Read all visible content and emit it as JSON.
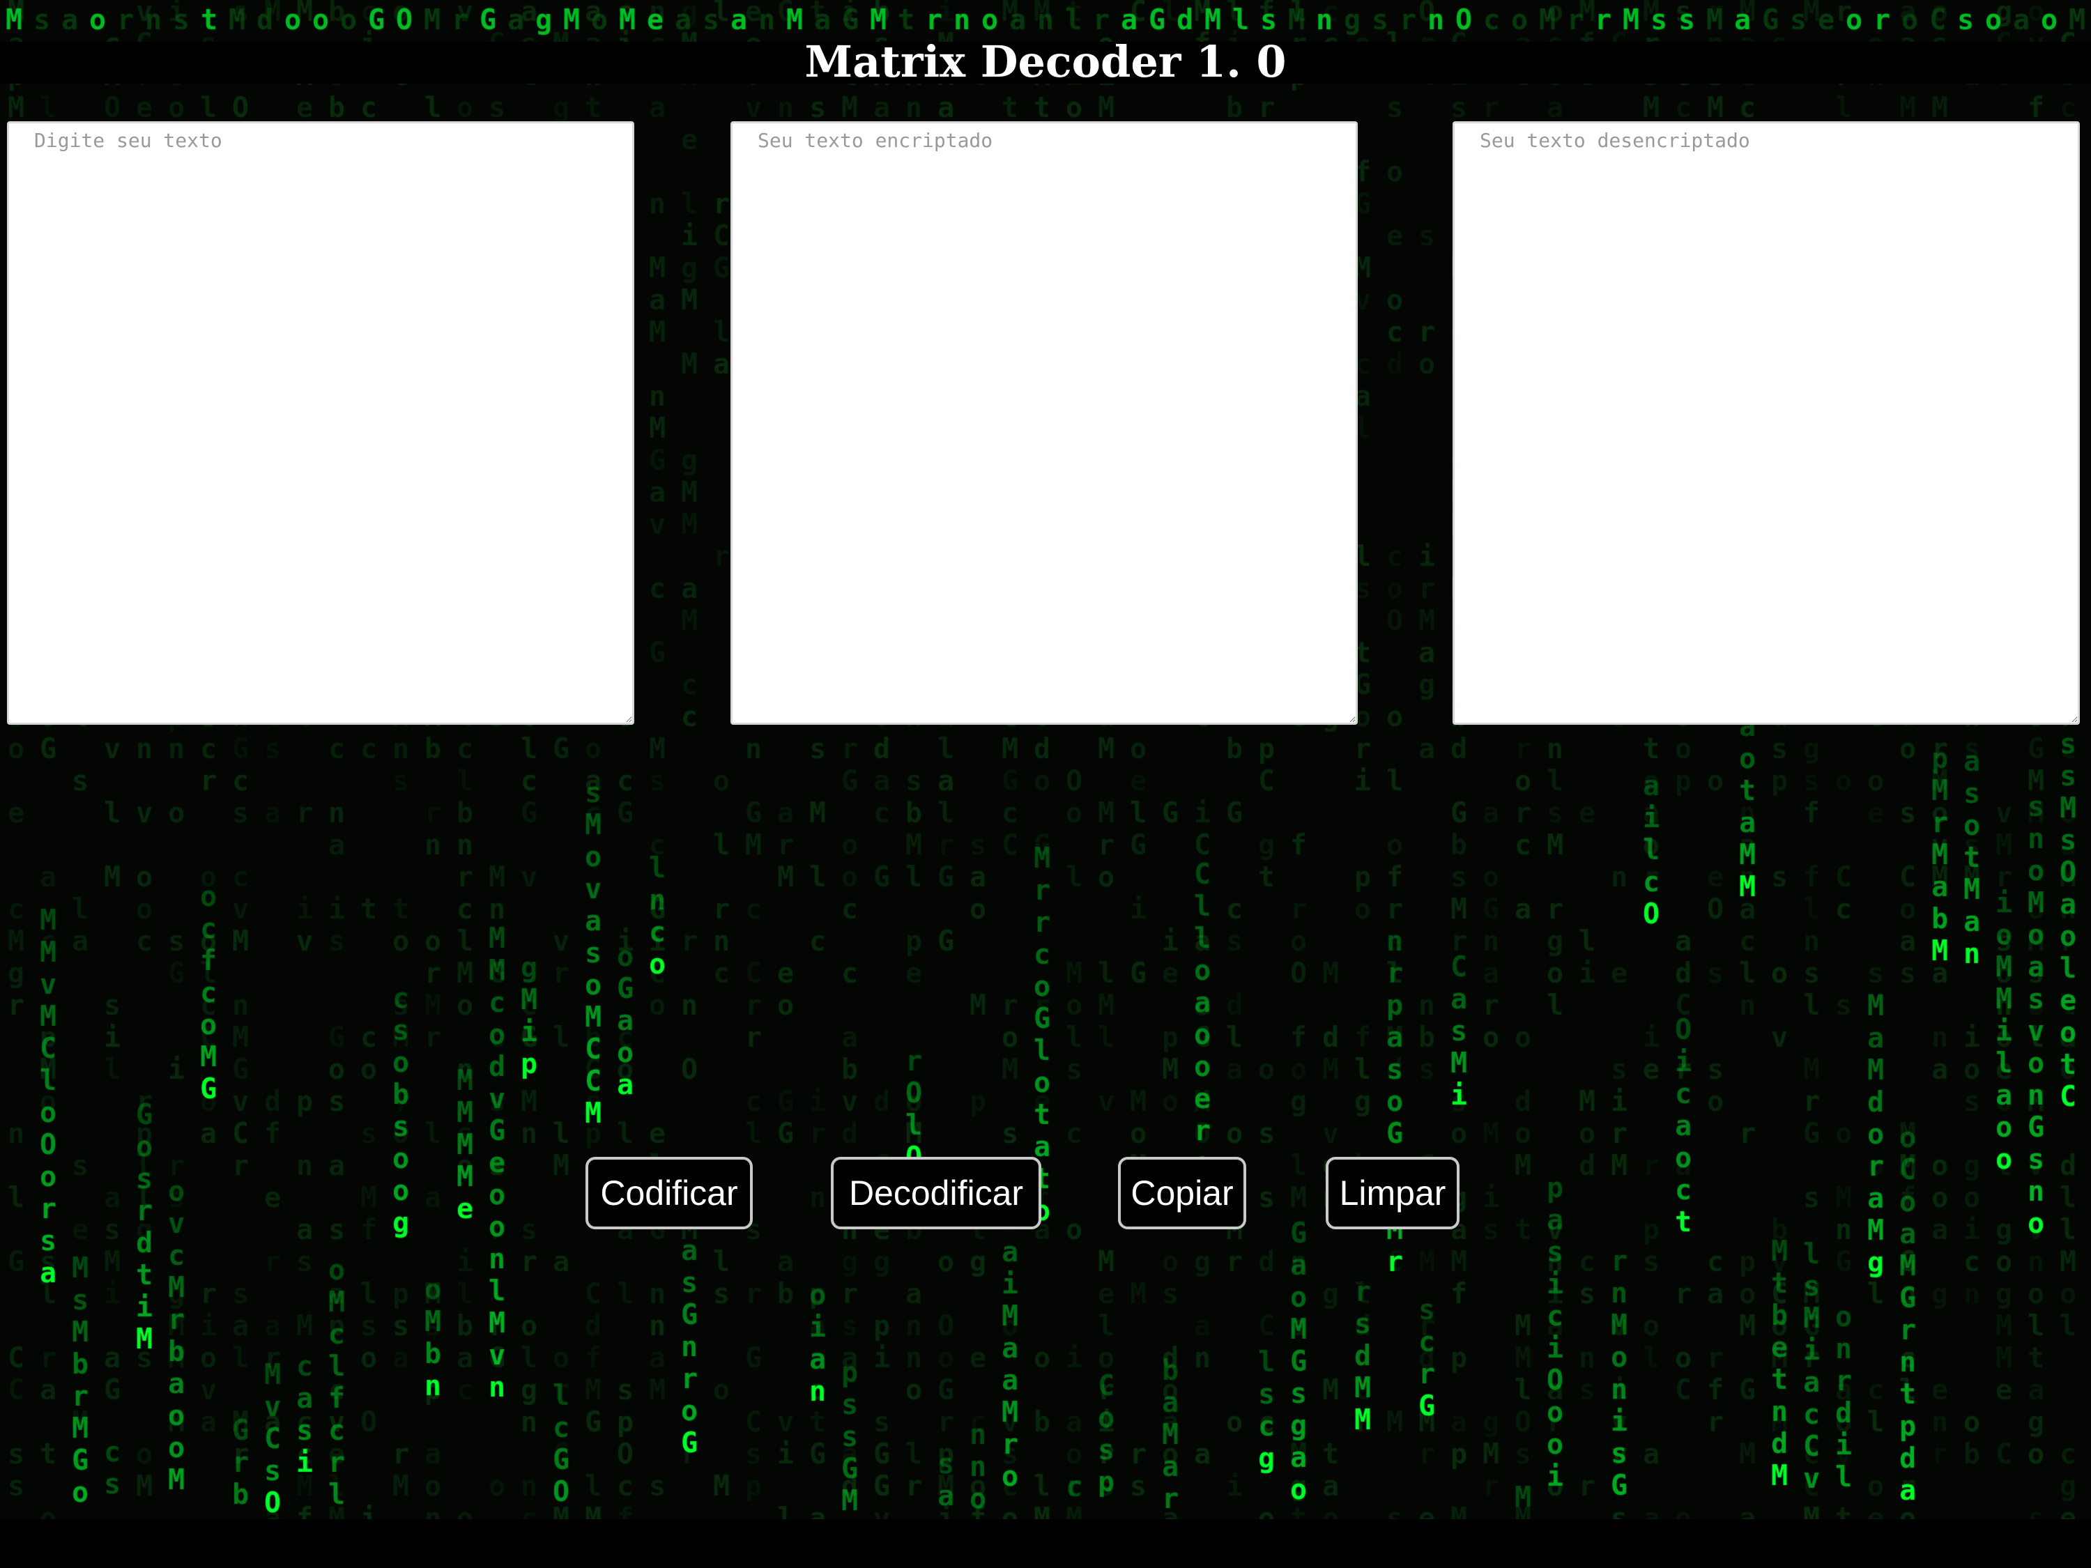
{
  "app": {
    "title": "Matrix Decoder 1. 0"
  },
  "fields": {
    "input_placeholder": "Digite seu texto",
    "input_value": "",
    "encrypted_placeholder": "Seu texto encriptado",
    "encrypted_value": "",
    "decrypted_placeholder": "Seu texto desencriptado",
    "decrypted_value": ""
  },
  "buttons": {
    "encode_label": "Codificar",
    "decode_label": "Decodificar",
    "copy_label": "Copiar",
    "clear_label": "Limpar"
  },
  "background": {
    "style": "matrix-digital-rain",
    "glyph_color": "#00ff2a",
    "dim_glyph_color": "#0a5f14",
    "base_color": "#030603",
    "glyphs": "GarCiossoaMlbMnetGcMrdlaosfgMvrnaplMcoGMoOiso"
  }
}
